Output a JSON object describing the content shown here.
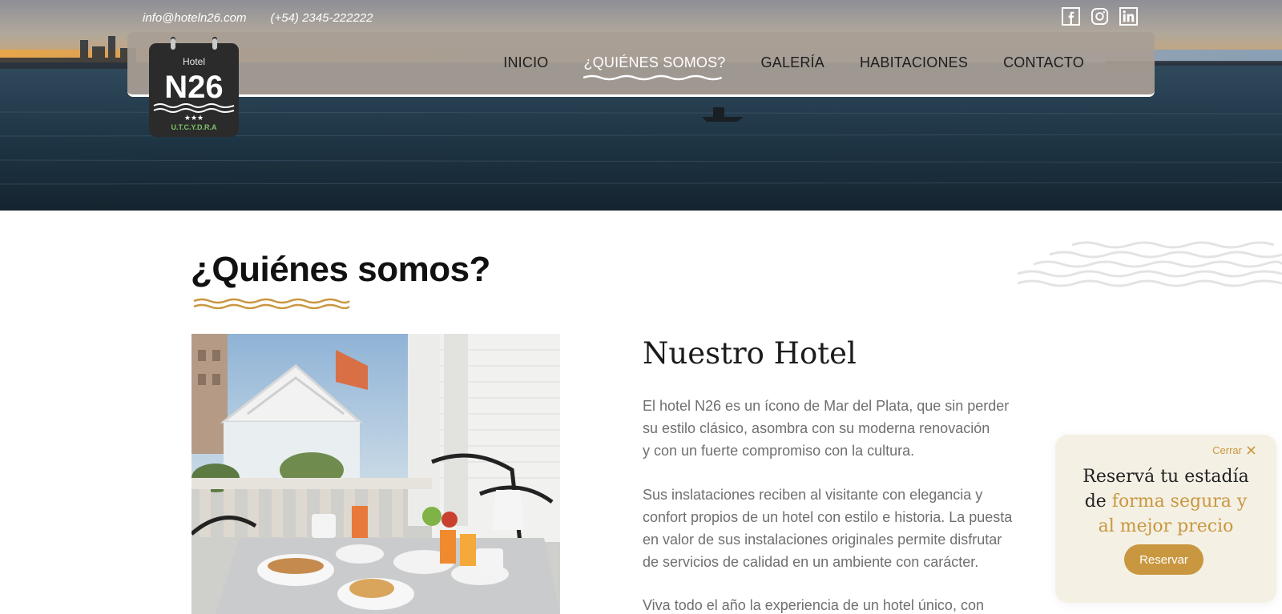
{
  "topbar": {
    "email": "info@hoteln26.com",
    "phone": "(+54) 2345-222222"
  },
  "social": [
    "facebook-icon",
    "instagram-icon",
    "linkedin-icon"
  ],
  "logo": {
    "top": "Hotel",
    "name": "N26",
    "stars": "★★★",
    "sub": "U.T.C.Y.D.R.A"
  },
  "nav": {
    "items": [
      "INICIO",
      "¿QUIÉNES SOMOS?",
      "GALERÍA",
      "HABITACIONES",
      "CONTACTO"
    ],
    "active_index": 1
  },
  "main": {
    "title": "¿Quiénes somos?",
    "subtitle": "Nuestro Hotel",
    "paragraph1": [
      "El hotel N26 es un ícono de Mar del Plata, que sin perder",
      "su estilo clásico, asombra con su moderna renovación",
      "y con un fuerte compromiso con la cultura."
    ],
    "paragraph2": [
      "Sus inslataciones reciben al visitante con elegancia y",
      "confort propios de un hotel con estilo e historia. La puesta",
      "en valor de sus instalaciones originales permite disfrutar",
      "de servicios de calidad en un ambiente con carácter."
    ],
    "paragraph3": [
      "Viva todo el año la experiencia de un hotel único, con"
    ]
  },
  "popup": {
    "close_label": "Cerrar",
    "title_line1": "Reservá tu estadía",
    "title_line2_plain": "de ",
    "title_line2_gold": "forma segura y",
    "title_line3_gold": "al mejor precio",
    "button_label": "Reservar"
  },
  "colors": {
    "gold": "#c9973f",
    "navbar": "#a89e94",
    "popup_bg": "#f4f0e4"
  }
}
